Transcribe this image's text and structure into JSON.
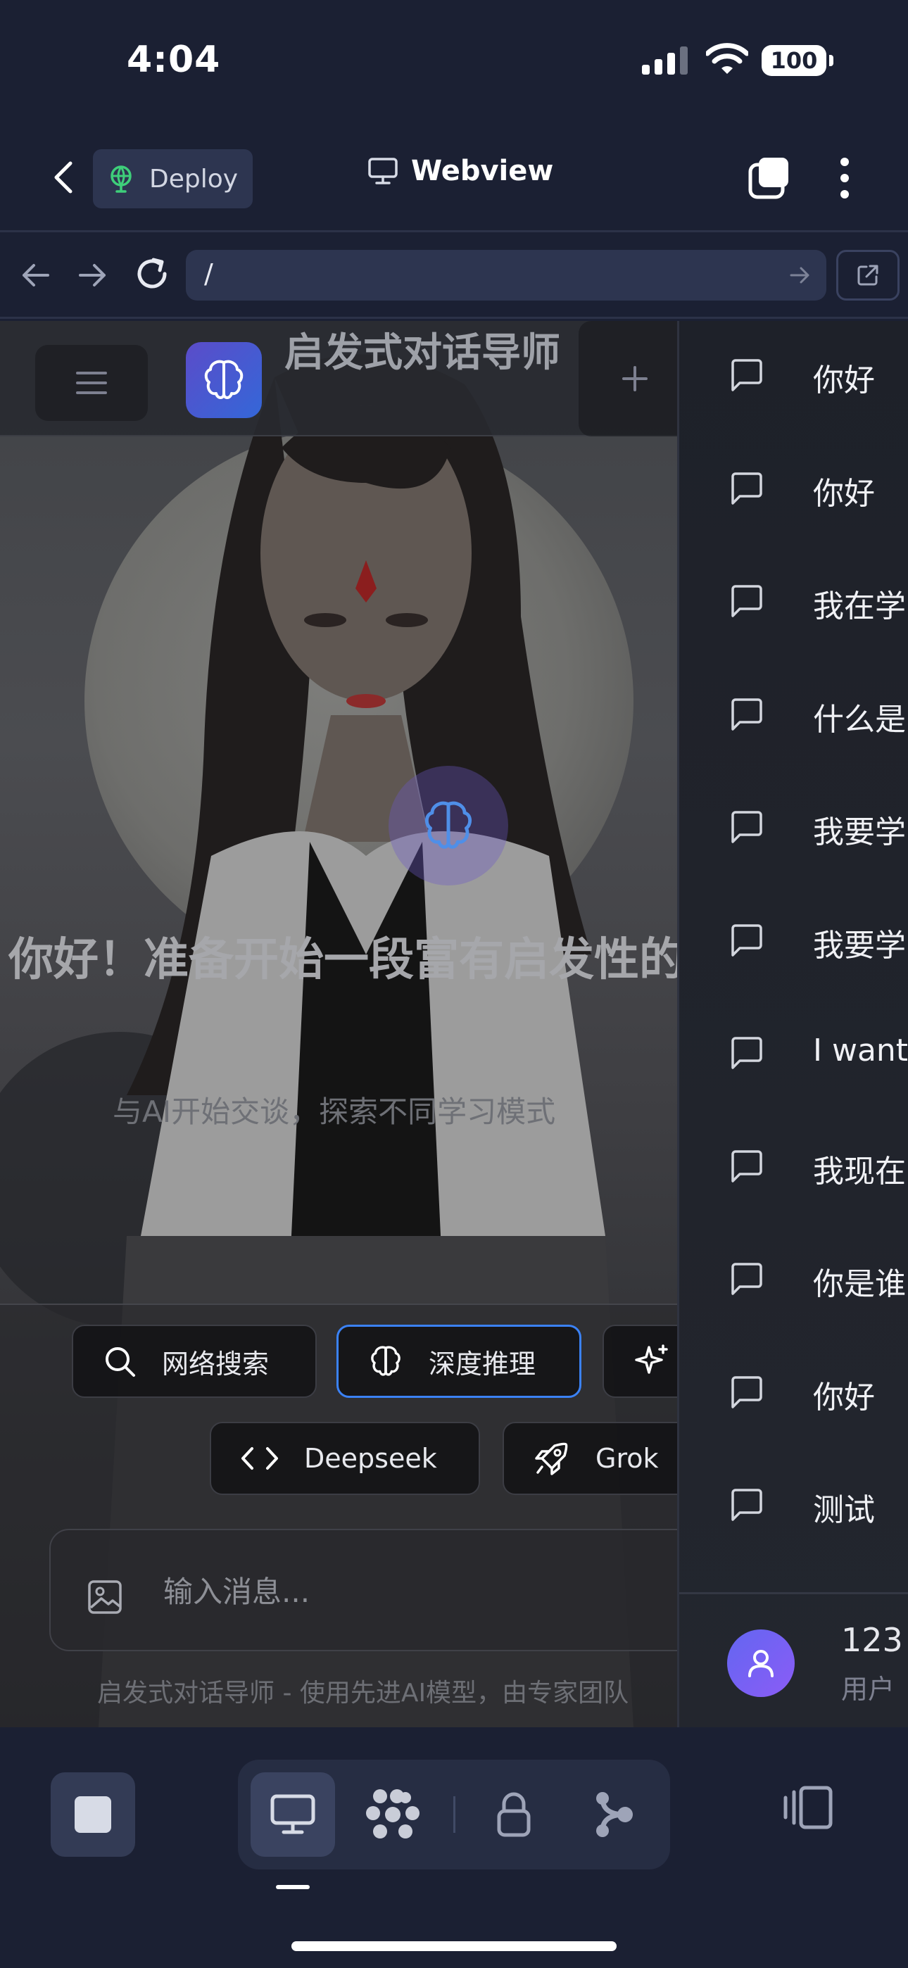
{
  "status_bar": {
    "time": "4:04",
    "battery": "100"
  },
  "app_header": {
    "deploy_label": "Deploy",
    "title": "Webview"
  },
  "url_bar": {
    "url": "/"
  },
  "site": {
    "brand_title": "启发式对话导师",
    "welcome_title": "你好！准备开始一段富有启发性的对话吗？",
    "welcome_subtitle": "与AI开始交谈，探索不同学习模式",
    "chips": [
      {
        "label": "网络搜索",
        "icon": "search-icon"
      },
      {
        "label": "深度推理",
        "icon": "brain-icon"
      },
      {
        "label": "",
        "icon": "sparkle-icon"
      },
      {
        "label": "Deepseek",
        "icon": "code-icon"
      },
      {
        "label": "Grok",
        "icon": "rocket-icon"
      }
    ],
    "message_placeholder": "输入消息...",
    "footer_note": "启发式对话导师 - 使用先进AI模型，由专家团队"
  },
  "drawer": {
    "conversations": [
      {
        "label": "你好"
      },
      {
        "label": "你好"
      },
      {
        "label": "我在学"
      },
      {
        "label": "什么是"
      },
      {
        "label": "我要学"
      },
      {
        "label": "我要学"
      },
      {
        "label": "I want"
      },
      {
        "label": "我现在"
      },
      {
        "label": "你是谁"
      },
      {
        "label": "你好"
      },
      {
        "label": "测试"
      }
    ],
    "user": {
      "name": "123",
      "role": "用户"
    }
  },
  "colors": {
    "background": "#1b2033",
    "accent_blue": "#3b82f6",
    "brand_gradient": [
      "#5b4cc9",
      "#3467d8"
    ],
    "avatar_gradient": [
      "#6366f1",
      "#8b5cf6"
    ]
  },
  "bottom_toolbar": {
    "tools": [
      "monitor-icon",
      "apps-icon",
      "lock-icon",
      "branch-icon"
    ],
    "selected_tool": "monitor-icon"
  }
}
